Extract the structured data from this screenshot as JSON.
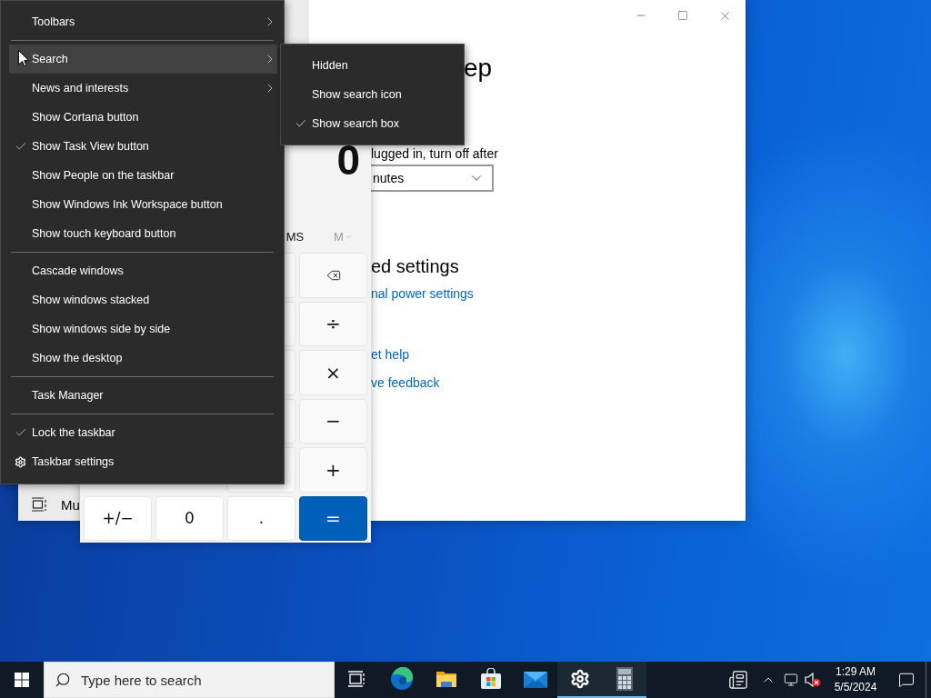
{
  "settings_window": {
    "sidebar": {
      "items": [
        {
          "label": "Mu"
        }
      ]
    },
    "content": {
      "heading": "ep",
      "plugged_label": "lugged in, turn off after",
      "dropdown_value": "nutes",
      "related_heading": "ed settings",
      "links": [
        "nal power settings",
        "et help",
        "ve feedback"
      ]
    }
  },
  "calculator": {
    "display": "0",
    "memory": [
      {
        "label": "MS",
        "kind": "plain",
        "disabled": false
      },
      {
        "label": "M",
        "kind": "dropdown",
        "disabled": true
      }
    ],
    "operator_keys": [
      {
        "kind": "backspace"
      },
      {
        "kind": "operator",
        "label": "÷"
      },
      {
        "kind": "operator",
        "label": "×"
      },
      {
        "kind": "operator",
        "label": "−"
      },
      {
        "kind": "operator",
        "label": "+"
      }
    ],
    "bottom_row": [
      {
        "kind": "digit",
        "label": "+/−"
      },
      {
        "kind": "digit",
        "label": "0"
      },
      {
        "kind": "digit",
        "label": "."
      },
      {
        "kind": "equals",
        "label": "="
      }
    ]
  },
  "menu": {
    "groups": [
      [
        {
          "label": "Toolbars",
          "kind": "submenu",
          "checked": false,
          "selected": false
        }
      ],
      [
        {
          "label": "Search",
          "kind": "submenu",
          "checked": false,
          "selected": true
        },
        {
          "label": "News and interests",
          "kind": "submenu",
          "checked": false,
          "selected": false
        },
        {
          "label": "Show Cortana button",
          "kind": "toggle",
          "checked": false,
          "selected": false
        },
        {
          "label": "Show Task View button",
          "kind": "toggle",
          "checked": true,
          "selected": false
        },
        {
          "label": "Show People on the taskbar",
          "kind": "toggle",
          "checked": false,
          "selected": false
        },
        {
          "label": "Show Windows Ink Workspace button",
          "kind": "toggle",
          "checked": false,
          "selected": false
        },
        {
          "label": "Show touch keyboard button",
          "kind": "toggle",
          "checked": false,
          "selected": false
        }
      ],
      [
        {
          "label": "Cascade windows",
          "kind": "command",
          "checked": false,
          "selected": false
        },
        {
          "label": "Show windows stacked",
          "kind": "command",
          "checked": false,
          "selected": false
        },
        {
          "label": "Show windows side by side",
          "kind": "command",
          "checked": false,
          "selected": false
        },
        {
          "label": "Show the desktop",
          "kind": "command",
          "checked": false,
          "selected": false
        }
      ],
      [
        {
          "label": "Task Manager",
          "kind": "command",
          "checked": false,
          "selected": false
        }
      ],
      [
        {
          "label": "Lock the taskbar",
          "kind": "toggle",
          "checked": true,
          "selected": false
        },
        {
          "label": "Taskbar settings",
          "kind": "settings",
          "checked": false,
          "selected": false
        }
      ]
    ]
  },
  "search_submenu": {
    "items": [
      {
        "label": "Hidden",
        "checked": false
      },
      {
        "label": "Show search icon",
        "checked": false
      },
      {
        "label": "Show search box",
        "checked": true
      }
    ]
  },
  "taskbar": {
    "search": {
      "placeholder": "Type here to search"
    },
    "apps": [
      {
        "kind": "task-view",
        "running": false
      },
      {
        "kind": "edge",
        "running": false
      },
      {
        "kind": "explorer",
        "running": false
      },
      {
        "kind": "store",
        "running": false
      },
      {
        "kind": "mail",
        "running": false
      },
      {
        "kind": "settings",
        "running": true
      },
      {
        "kind": "calculator",
        "running": true
      }
    ],
    "tray": {
      "time": "1:29 AM",
      "date": "5/5/2024"
    }
  }
}
